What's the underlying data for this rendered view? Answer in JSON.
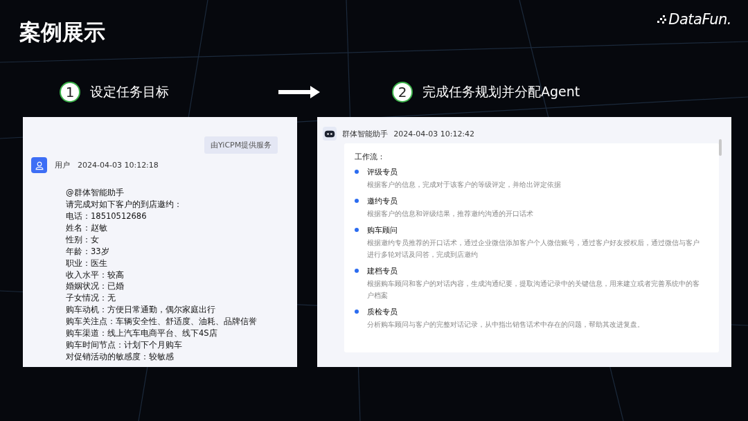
{
  "title": "案例展示",
  "logo": "DataFun.",
  "steps": [
    {
      "number": "1",
      "label": "设定任务目标"
    },
    {
      "number": "2",
      "label": "完成任务规划并分配Agent"
    }
  ],
  "left_panel": {
    "service_badge": "由YiCPM提供服务",
    "sender": "用户",
    "time": "2024-04-03 10:12:18",
    "lines": [
      "@群体智能助手",
      "请完成对如下客户的到店邀约：",
      "电话：18510512686",
      "姓名：赵敏",
      "性别：女",
      "年龄：33岁",
      "职业：医生",
      "收入水平：较高",
      "婚姻状况：已婚",
      "子女情况：无",
      "购车动机：方便日常通勤，偶尔家庭出行",
      "购车关注点：车辆安全性、舒适度、油耗、品牌信誉",
      "购车渠道：线上汽车电商平台、线下4S店",
      "购车时间节点：计划下个月购车",
      "对促销活动的敏感度：较敏感"
    ]
  },
  "right_panel": {
    "sender": "群体智能助手",
    "time": "2024-04-03 10:12:42",
    "heading": "工作流：",
    "workflow": [
      {
        "title": "评级专员",
        "description": "根据客户的信息，完成对于该客户的等级评定，并给出评定依据"
      },
      {
        "title": "邀约专员",
        "description": "根据客户的信息和评级结果，推荐邀约沟通的开口话术"
      },
      {
        "title": "购车顾问",
        "description": "根据邀约专员推荐的开口话术，通过企业微信添加客户个人微信账号，通过客户好友授权后，通过微信与客户进行多轮对话及问答，完成到店邀约"
      },
      {
        "title": "建档专员",
        "description": "根据购车顾问和客户的对话内容，生成沟通纪要，提取沟通记录中的关键信息，用来建立或者完善系统中的客户档案"
      },
      {
        "title": "质检专员",
        "description": "分析购车顾问与客户的完整对话记录，从中指出销售话术中存在的问题，帮助其改进复盘。"
      }
    ]
  }
}
